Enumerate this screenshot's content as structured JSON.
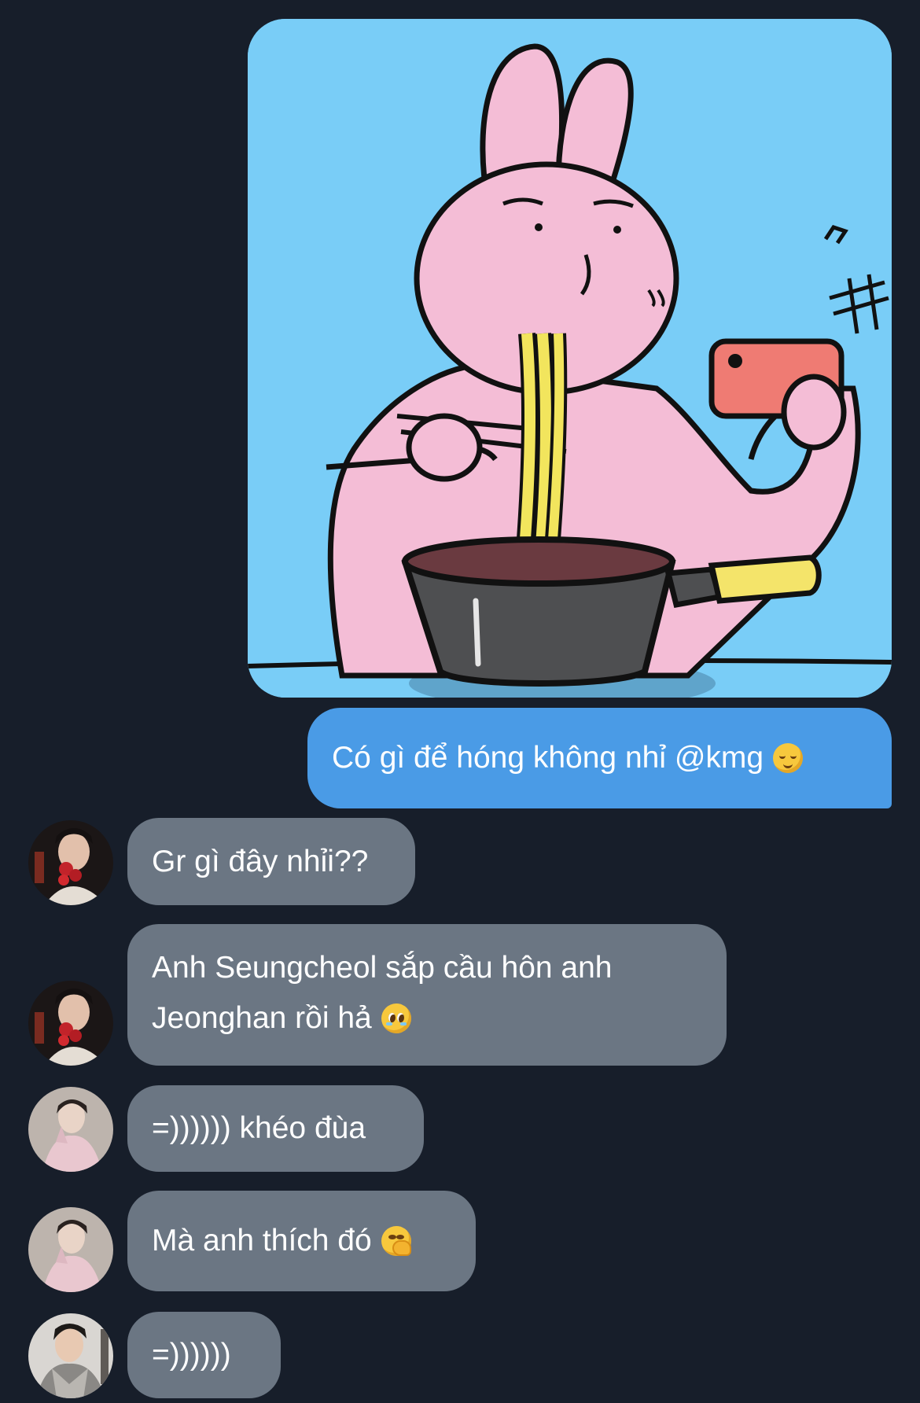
{
  "messages": [
    {
      "direction": "outgoing",
      "text": "Có gì để hóng không nhỉ @kmg",
      "emoji": "relieved-face-emoji"
    },
    {
      "direction": "incoming",
      "avatar": "avatar-with-roses",
      "text": "Gr gì đây nhỉi??"
    },
    {
      "direction": "incoming",
      "avatar": "avatar-with-roses",
      "text_line1": "Anh Seungcheol sắp cầu hôn anh",
      "text_line2": "Jeonghan rồi hả",
      "emoji": "pleading-face-emoji"
    },
    {
      "direction": "incoming",
      "avatar": "avatar-pink-sweater",
      "text": "=)))))) khéo đùa"
    },
    {
      "direction": "incoming",
      "avatar": "avatar-pink-sweater",
      "text": "Mà anh thích đó",
      "emoji": "face-with-hand-over-mouth-emoji"
    },
    {
      "direction": "incoming",
      "avatar": "avatar-grey-scarf",
      "text": "=))))))"
    }
  ],
  "sticker": {
    "name": "pink-rabbit-eating-noodles-sticker",
    "colors": {
      "background": "#79cdf7",
      "rabbit": "#f4bdd6",
      "noodles": "#f2e55d",
      "pot": "#4e4f51",
      "phone": "#ef7b73",
      "handle": "#f4e46a"
    }
  },
  "colors": {
    "background": "#171e2a",
    "outgoing_bubble": "#4a9be6",
    "incoming_bubble": "#6b7683",
    "text": "#ffffff"
  }
}
